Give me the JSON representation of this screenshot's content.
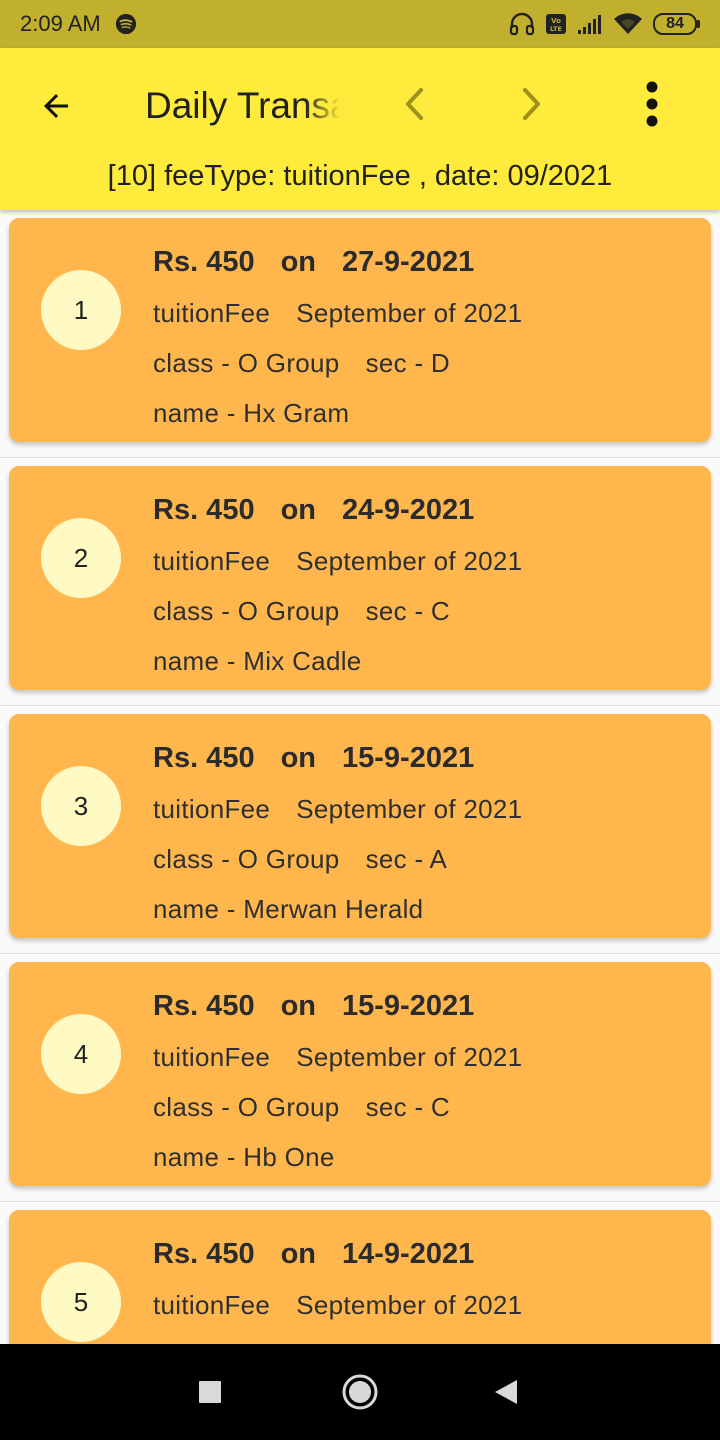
{
  "status_bar": {
    "time": "2:09 AM",
    "battery": "84",
    "icons": [
      "spotify-icon",
      "headphones-icon",
      "volte-icon",
      "signal-icon",
      "wifi-icon",
      "battery-icon"
    ]
  },
  "app_bar": {
    "title": "Daily Transactions",
    "subtitle": "[10]  feeType: tuitionFee , date: 09/2021",
    "icons": [
      "back-arrow-icon",
      "chevron-left-icon",
      "chevron-right-icon",
      "more-vert-icon"
    ]
  },
  "colors": {
    "status_bar": "#c0b02e",
    "app_bar": "#ffeb3b",
    "card": "#ffb74d",
    "avatar": "#fff9c4",
    "nav_bar": "#000000"
  },
  "transactions": [
    {
      "index": "1",
      "amount": "Rs. 450",
      "on": "on",
      "date": "27-9-2021",
      "fee_type": "tuitionFee",
      "period": "September of 2021",
      "class": "class - O Group",
      "section": "sec - D",
      "name": "name - Hx Gram"
    },
    {
      "index": "2",
      "amount": "Rs. 450",
      "on": "on",
      "date": "24-9-2021",
      "fee_type": "tuitionFee",
      "period": "September of 2021",
      "class": "class - O Group",
      "section": "sec - C",
      "name": "name - Mix Cadle"
    },
    {
      "index": "3",
      "amount": "Rs. 450",
      "on": "on",
      "date": "15-9-2021",
      "fee_type": "tuitionFee",
      "period": "September of 2021",
      "class": "class - O Group",
      "section": "sec - A",
      "name": "name - Merwan Herald"
    },
    {
      "index": "4",
      "amount": "Rs. 450",
      "on": "on",
      "date": "15-9-2021",
      "fee_type": "tuitionFee",
      "period": "September of 2021",
      "class": "class - O Group",
      "section": "sec - C",
      "name": "name - Hb One"
    },
    {
      "index": "5",
      "amount": "Rs. 450",
      "on": "on",
      "date": "14-9-2021",
      "fee_type": "tuitionFee",
      "period": "September of 2021",
      "class": "",
      "section": "",
      "name": ""
    }
  ],
  "nav_bar": {
    "icons": [
      "recents-square-icon",
      "home-circle-icon",
      "back-triangle-icon"
    ]
  }
}
